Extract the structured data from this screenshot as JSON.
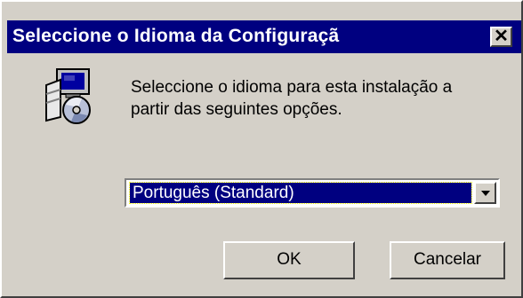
{
  "window": {
    "title": "Seleccione o Idioma da Configuraçã",
    "close_label": "✕"
  },
  "dialog": {
    "message_line1": "Seleccione o idioma para esta instalação a",
    "message_line2": "partir das seguintes opções.",
    "language_select": {
      "selected": "Português (Standard)"
    },
    "ok_label": "OK",
    "cancel_label": "Cancelar"
  },
  "colors": {
    "titlebar": "#000080",
    "face": "#d4d0c8",
    "selection": "#000080"
  },
  "icons": {
    "setup": "setup-computer-cd-icon",
    "dropdown": "chevron-down-icon",
    "close": "close-icon"
  }
}
